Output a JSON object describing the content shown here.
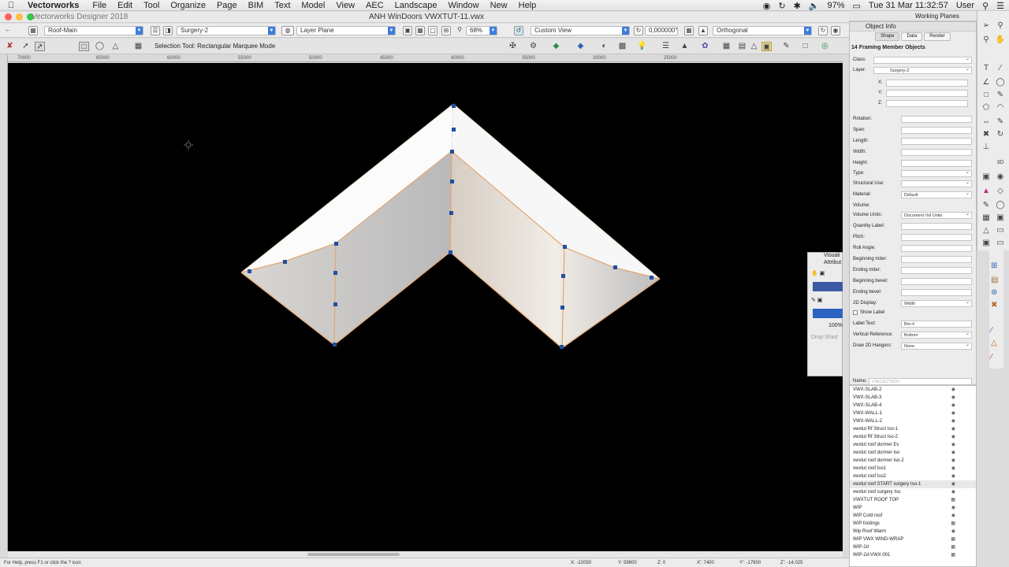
{
  "menubar": {
    "app_name": "Vectorworks",
    "items": [
      "File",
      "Edit",
      "Tool",
      "Organize",
      "Page",
      "BIM",
      "Text",
      "Model",
      "View",
      "AEC",
      "Landscape",
      "Window",
      "New",
      "Help"
    ],
    "battery": "97%",
    "clock": "Tue 31 Mar  11:32:57",
    "user": "User"
  },
  "window": {
    "app_version": "Vectorworks Designer 2018",
    "doc_title": "ANH WinDoors VWXTUT-11.vwx",
    "colors": {
      "close": "#fc605c",
      "min": "#fdbc40",
      "max": "#34c84a"
    }
  },
  "viewbar": {
    "class": "Roof-Main",
    "layer": "Surgery-2",
    "plane": "Layer Plane",
    "zoom": "68%",
    "view": "Custom View",
    "rotation": "0,000000°",
    "projection": "Orthogonal"
  },
  "modebar": {
    "mode_text": "Selection Tool: Rectangular Marquee Mode"
  },
  "ruler": {
    "top_labels": [
      "70000",
      "65000",
      "60000",
      "55000",
      "50000",
      "45000",
      "40000",
      "35000",
      "30000",
      "25000"
    ]
  },
  "canvas": {
    "background": "#000000",
    "roof_edge_color": "#e3a56e",
    "handle_color": "#1f4fa0"
  },
  "status": {
    "help": "For Help, press F1 or click the ? icon",
    "x": "X: -22050",
    "y": "Y: 59800",
    "z": "Z: 0",
    "dx": "X': 7400",
    "dy": "Y': -17900",
    "dz": "Z': -14.025"
  },
  "working_planes": {
    "title": "Working Planes"
  },
  "object_info": {
    "title": "Object Info",
    "tabs": [
      "Shape",
      "Data",
      "Render"
    ],
    "object_type": "14 Framing Member Objects",
    "class_label": "Class:",
    "layer_label": "Layer:",
    "layer_value": "Surgery-2",
    "xyz": [
      "X:",
      "Y:",
      "Z:"
    ],
    "fields": [
      {
        "label": "Rotation:",
        "value": ""
      },
      {
        "label": "Span:",
        "value": ""
      },
      {
        "label": "Length:",
        "value": ""
      },
      {
        "label": "Width:",
        "value": ""
      },
      {
        "label": "Height:",
        "value": ""
      },
      {
        "label": "Type:",
        "value": ""
      },
      {
        "label": "Structural Use:",
        "value": ""
      },
      {
        "label": "Material:",
        "value": "Default"
      },
      {
        "label": "Volume:",
        "value": ""
      },
      {
        "label": "Volume Units:",
        "value": "Document Vol Units"
      },
      {
        "label": "Quantity Label:",
        "value": ""
      },
      {
        "label": "Pitch:",
        "value": ""
      },
      {
        "label": "Roll Angle:",
        "value": ""
      },
      {
        "label": "Beginning miter:",
        "value": ""
      },
      {
        "label": "Ending miter:",
        "value": ""
      },
      {
        "label": "Beginning bevel:",
        "value": ""
      },
      {
        "label": "Ending bevel:",
        "value": ""
      },
      {
        "label": "2D Display:",
        "value": "Width"
      }
    ],
    "show_label": "Show Label",
    "label_text_label": "Label Text:",
    "label_text_value": "Bm-#",
    "vertical_ref_label": "Vertical Reference:",
    "vertical_ref_value": "Bottom",
    "draw_hangers_label": "Draw 2D Hangers:",
    "draw_hangers_value": "None",
    "name_label": "Name:",
    "name_value": "<SELECTED>"
  },
  "resources": {
    "items": [
      "VWX-SLAB-2",
      "VWX-SLAB-3",
      "VWX-SLAB-4",
      "VWX-WALL-1",
      "VWX-WALL-2",
      "vwxtut Rf Struct Iso-1",
      "vwxtut Rf Struct Iso-2",
      "vwxtut roof dormer Ev",
      "vwxtut roof dormer Iso",
      "vwxtut roof dormer Iso-2",
      "vwxtut roof Iso1",
      "vwxtut roof Iso2",
      "vwxtut roof START surgery Iso-1",
      "vwxtut roof surgery Iso",
      "VWXTUT ROOF TOP",
      "WIP",
      "WIP Cold roof",
      "WIP footings",
      "Wip Roof Warm",
      "WIP VWX WIND-WRAP",
      "WIP-2d",
      "WIP-2d-VWX 001"
    ]
  },
  "attributes": {
    "title1": "Visuali",
    "title2": "Attribut",
    "opacity": "100%",
    "drop_shadow": "Drop Shad"
  }
}
